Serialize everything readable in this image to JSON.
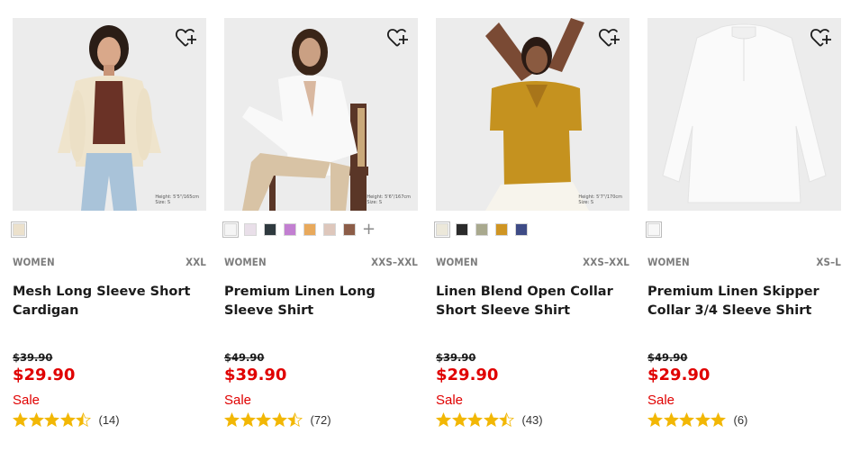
{
  "products": [
    {
      "gender": "WOMEN",
      "sizes": "XXL",
      "name": "Mesh Long Sleeve Short Cardigan",
      "original_price": "$39.90",
      "price": "$29.90",
      "sale_label": "Sale",
      "rating": 4.5,
      "review_count": "(14)",
      "height_note_1": "Height: 5'5\"/165cm",
      "height_note_2": "Size: S",
      "swatches": [
        "#ece1cc"
      ],
      "more_swatches": false
    },
    {
      "gender": "WOMEN",
      "sizes": "XXS–XXL",
      "name": "Premium Linen Long Sleeve Shirt",
      "original_price": "$49.90",
      "price": "$39.90",
      "sale_label": "Sale",
      "rating": 4.5,
      "review_count": "(72)",
      "height_note_1": "Height: 5'6\"/167cm",
      "height_note_2": "Size: S",
      "swatches": [
        "#f5f5f5",
        "#e9dfe9",
        "#2f3a3f",
        "#c27fd1",
        "#e8a95c",
        "#dec7bc",
        "#8c5d48"
      ],
      "more_swatches": true
    },
    {
      "gender": "WOMEN",
      "sizes": "XXS–XXL",
      "name": "Linen Blend Open Collar Short Sleeve Shirt",
      "original_price": "$39.90",
      "price": "$29.90",
      "sale_label": "Sale",
      "rating": 4.5,
      "review_count": "(43)",
      "height_note_1": "Height: 5'7\"/170cm",
      "height_note_2": "Size: S",
      "swatches": [
        "#ece8da",
        "#2b2b2b",
        "#a9a98e",
        "#cf9523",
        "#3e4b86"
      ],
      "more_swatches": false
    },
    {
      "gender": "WOMEN",
      "sizes": "XS–L",
      "name": "Premium Linen Skipper Collar 3/4 Sleeve Shirt",
      "original_price": "$49.90",
      "price": "$29.90",
      "sale_label": "Sale",
      "rating": 5,
      "review_count": "(6)",
      "height_note_1": "",
      "height_note_2": "",
      "swatches": [
        "#f7f7f7"
      ],
      "more_swatches": false
    }
  ],
  "colors": {
    "sale_red": "#e00000",
    "star_gold": "#f2b705",
    "meta_gray": "#7d7d7d"
  },
  "icons": {
    "favorite": "heart-plus-icon",
    "star": "star-icon",
    "more": "plus-icon"
  }
}
